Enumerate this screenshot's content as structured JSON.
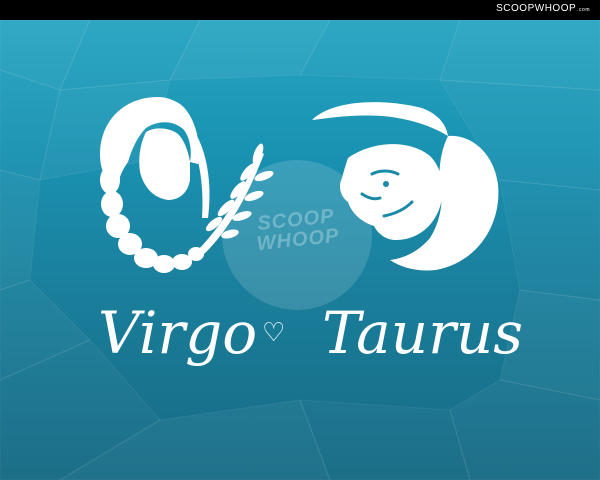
{
  "header": {
    "brand": "SCOOPWHOOP",
    "brand_suffix": ".com"
  },
  "watermark": {
    "line1": "SCOOP",
    "line2": "WHOOP"
  },
  "left_sign": {
    "name": "Virgo",
    "icon": "virgo-icon"
  },
  "right_sign": {
    "name": "Taurus",
    "icon": "taurus-icon"
  },
  "separator": {
    "icon": "heart-icon",
    "glyph": "♡"
  },
  "colors": {
    "background_top": "#2aa8c4",
    "background_bottom": "#166a84",
    "foreground": "#ffffff"
  }
}
